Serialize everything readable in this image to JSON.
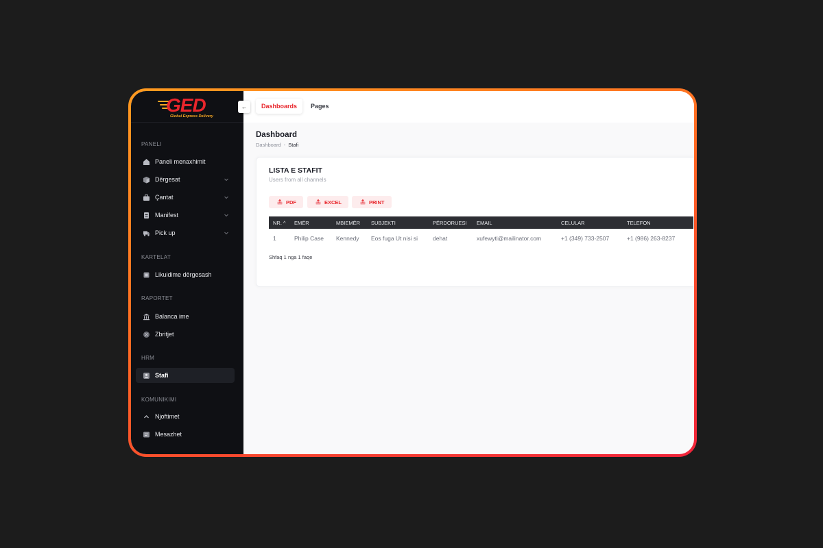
{
  "brand": {
    "name": "GED",
    "tagline": "Global Express Delivery",
    "primary_color": "#e8262c",
    "accent_color": "#f5a623"
  },
  "sidebar": {
    "sections": [
      {
        "title": "PANELI"
      },
      {
        "title": "KARTELAT"
      },
      {
        "title": "RAPORTET"
      },
      {
        "title": "HRM"
      },
      {
        "title": "KOMUNIKIMI"
      }
    ],
    "items": [
      {
        "label": "Paneli menaxhimit",
        "icon": "home-icon",
        "has_submenu": false
      },
      {
        "label": "Dërgesat",
        "icon": "box-icon",
        "has_submenu": true
      },
      {
        "label": "Çantat",
        "icon": "bag-icon",
        "has_submenu": true
      },
      {
        "label": "Manifest",
        "icon": "document-icon",
        "has_submenu": true
      },
      {
        "label": "Pick up",
        "icon": "truck-icon",
        "has_submenu": true
      },
      {
        "label": "Likuidime dërgesash",
        "icon": "square-icon",
        "has_submenu": false
      },
      {
        "label": "Balanca ime",
        "icon": "bank-icon",
        "has_submenu": false
      },
      {
        "label": "Zbritjet",
        "icon": "discount-icon",
        "has_submenu": false
      },
      {
        "label": "Stafi",
        "icon": "user-icon",
        "has_submenu": false,
        "active": true
      },
      {
        "label": "Njoftimet",
        "icon": "chevron-up-icon",
        "has_submenu": false
      },
      {
        "label": "Mesazhet",
        "icon": "message-icon",
        "has_submenu": false
      }
    ]
  },
  "header": {
    "tabs": [
      {
        "label": "Dashboards",
        "active": true
      },
      {
        "label": "Pages",
        "active": false
      }
    ],
    "toggle_icon": "arrow-left-icon"
  },
  "page": {
    "title": "Dashboard",
    "breadcrumb": [
      "Dashboard",
      "Stafi"
    ]
  },
  "card": {
    "title": "LISTA E STAFIT",
    "subtitle": "Users from all channels",
    "export_buttons": [
      "PDF",
      "EXCEL",
      "PRINT"
    ],
    "table": {
      "columns": [
        "NR.",
        "EMËR",
        "MBIEMËR",
        "SUBJEKTI",
        "PËRDORUESI",
        "EMAIL",
        "CELULAR",
        "TELEFON"
      ],
      "rows": [
        [
          "1",
          "Philip Case",
          "Kennedy",
          "Eos fuga Ut nisi si",
          "dehat",
          "xufewyti@mailinator.com",
          "+1 (349) 733-2507",
          "+1 (986) 263-8237"
        ]
      ]
    },
    "footer": "Shfaq 1 nga 1 faqe"
  }
}
